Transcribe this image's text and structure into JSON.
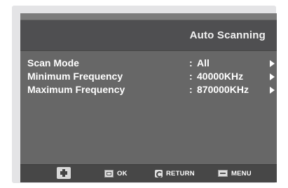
{
  "header": {
    "title": "Auto Scanning"
  },
  "menu": {
    "items": [
      {
        "label": "Scan Mode",
        "colon": ":",
        "value": "All"
      },
      {
        "label": "Minimum Frequency",
        "colon": ":",
        "value": "40000KHz"
      },
      {
        "label": "Maximum Frequency",
        "colon": ":",
        "value": "870000KHz"
      }
    ]
  },
  "footer": {
    "ok_label": "OK",
    "return_label": "RETURN",
    "menu_label": "MENU"
  },
  "icons": {
    "navigate": "navigate-icon",
    "ok": "ok-icon",
    "return": "return-icon",
    "menu": "menu-icon",
    "arrow": "arrow-right-icon"
  },
  "colors": {
    "panel": "#676767",
    "header": "#4f4f51",
    "footer": "#474747",
    "text": "#ffffff"
  }
}
